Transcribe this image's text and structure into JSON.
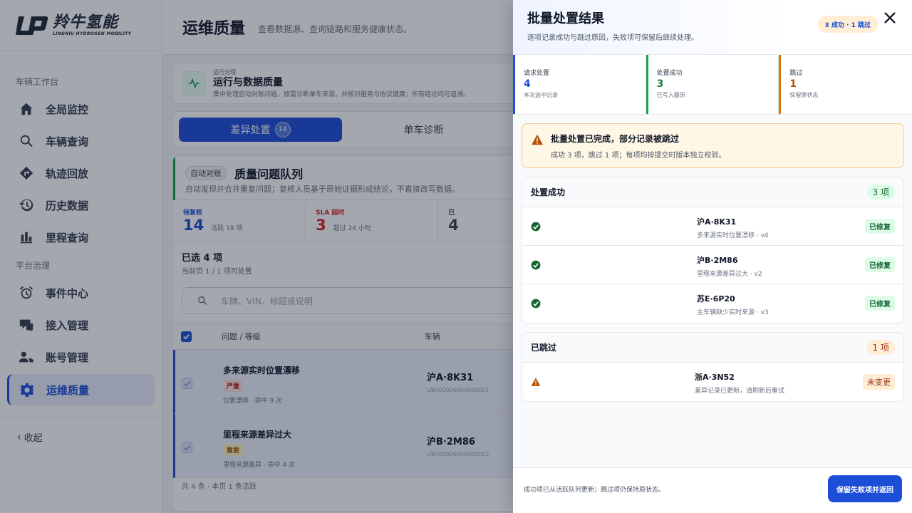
{
  "brand": {
    "cn": "羚牛氢能",
    "en": "LINGNIU HYDROGEN MOBILITY"
  },
  "sidebar": {
    "group1": "车辆工作台",
    "group2": "平台治理",
    "items": [
      {
        "label": "全局监控",
        "icon": "home-icon"
      },
      {
        "label": "车辆查询",
        "icon": "search-icon"
      },
      {
        "label": "轨迹回放",
        "icon": "route-icon"
      },
      {
        "label": "历史数据",
        "icon": "history-icon"
      },
      {
        "label": "里程查询",
        "icon": "bar-chart-icon"
      },
      {
        "label": "事件中心",
        "icon": "alarm-icon"
      },
      {
        "label": "接入管理",
        "icon": "connect-icon"
      },
      {
        "label": "账号管理",
        "icon": "users-icon"
      },
      {
        "label": "运维质量",
        "icon": "gear-icon"
      }
    ],
    "collapse": "收起"
  },
  "header": {
    "title": "运维质量",
    "subtitle": "查看数据源、查询链路和服务健康状态。"
  },
  "ops": {
    "tag": "运行治理",
    "title": "运行与数据质量",
    "desc": "集中处理自动对账问题，按需诊断单车来源，并核对服务与协议健康；所有结论均可追溯。"
  },
  "tabs": [
    {
      "label": "差异处置",
      "badge": "14"
    },
    {
      "label": "单车诊断"
    }
  ],
  "queue": {
    "tag": "自动对账",
    "title": "质量问题队列",
    "desc": "自动发现并合并重复问题；复核人员基于原始证据形成结论，不直接改写数据。",
    "stats": [
      {
        "label": "待复核",
        "value": "14",
        "note": "活跃 18 项"
      },
      {
        "label": "SLA 超时",
        "value": "3",
        "note": "超过 24 小时"
      },
      {
        "label": "已",
        "value": "4",
        "note": ""
      }
    ],
    "selected": "已选 4 项",
    "selected_sub": "当前页 1 / 1 项可处置",
    "search_placeholder": "车牌、VIN、标题或说明",
    "col_issue": "问题 / 等级",
    "col_vehicle": "车辆",
    "rows": [
      {
        "title": "多来源实时位置漂移",
        "severity": "严重",
        "meta": "位置漂移 · 命中 9 次",
        "plate": "沪A·8K31",
        "vin": "LNU00000000000001"
      },
      {
        "title": "里程来源差异过大",
        "severity": "重要",
        "meta": "里程来源差异 · 命中 4 次",
        "plate": "沪B·2M86",
        "vin": "LNU00000000000002"
      }
    ],
    "footer": "共 4 条 · 本页 1 条活跃"
  },
  "drawer": {
    "title": "批量处置结果",
    "subtitle": "逐项记录成功与跳过原因，失败项可保留后继续处理。",
    "badge": "3 成功 · 1 跳过",
    "stats": [
      {
        "label": "请求处置",
        "value": "4",
        "note": "本次选中记录",
        "color": "#1d4ed8"
      },
      {
        "label": "处置成功",
        "value": "3",
        "note": "已写入履历",
        "color": "#15803d"
      },
      {
        "label": "跳过",
        "value": "1",
        "note": "保留原状态",
        "color": "#b45309"
      }
    ],
    "alert": {
      "title": "批量处置已完成，部分记录被跳过",
      "desc": "成功 3 项，跳过 1 项；每项均按提交时版本独立校验。"
    },
    "success_section": {
      "title": "处置成功",
      "count": "3 项",
      "items": [
        {
          "plate": "沪A·8K31",
          "desc": "多来源实时位置漂移 · v4",
          "status": "已修复"
        },
        {
          "plate": "沪B·2M86",
          "desc": "里程来源差异过大 · v2",
          "status": "已修复"
        },
        {
          "plate": "苏E·6P20",
          "desc": "主车辆缺少实时来源 · v3",
          "status": "已修复"
        }
      ]
    },
    "skip_section": {
      "title": "已跳过",
      "count": "1 项",
      "items": [
        {
          "plate": "浙A·3N52",
          "desc": "差异记录已更新，请刷新后重试",
          "status": "未变更"
        }
      ]
    },
    "footer_text": "成功项已从活跃队列更新；跳过项仍保持原状态。",
    "footer_button": "保留失败项并返回"
  }
}
